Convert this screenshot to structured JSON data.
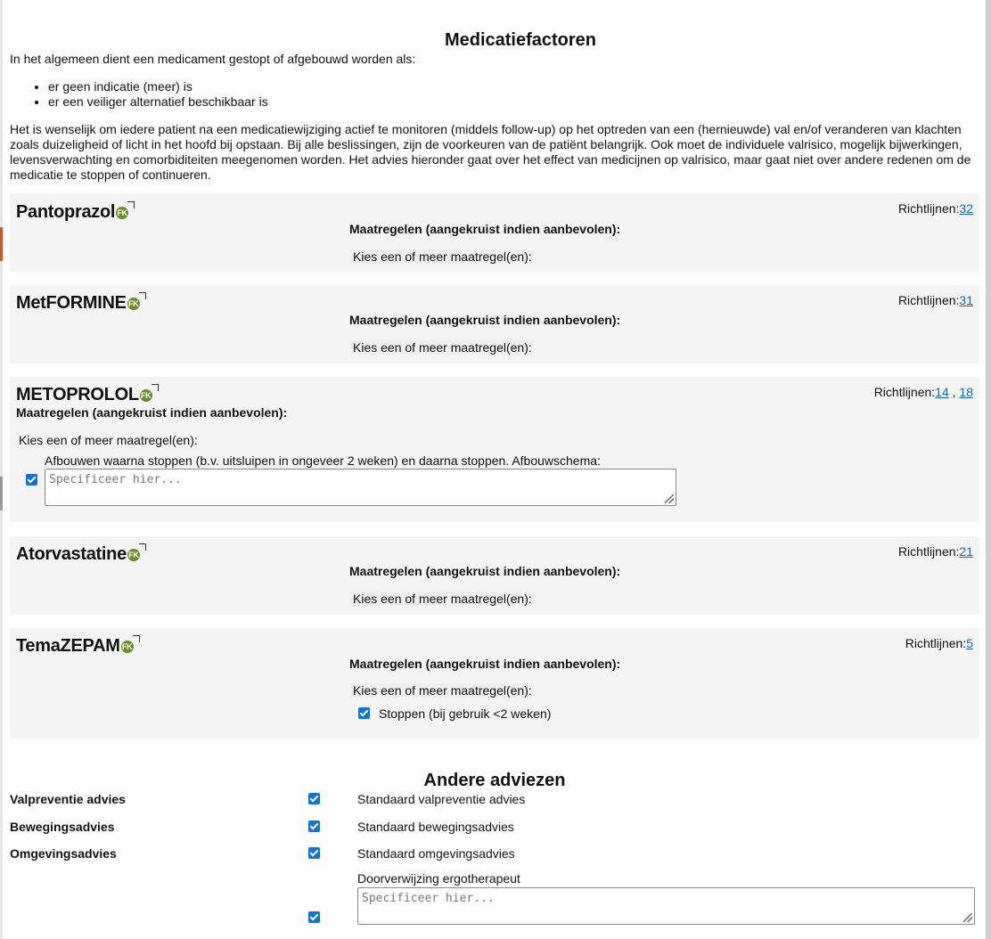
{
  "title": "Medicatiefactoren",
  "intro": {
    "lead": "In het algemeen dient een medicament gestopt of afgebouwd worden als:",
    "bullets": [
      "er geen indicatie (meer) is",
      "er een veiliger alternatief beschikbaar is"
    ],
    "paragraph": "Het is wenselijk om iedere patient na een medicatiewijziging actief te monitoren (middels follow-up) op het optreden van een (hernieuwde) val en/of veranderen van klachten zoals duizeligheid of licht in het hoofd bij opstaan. Bij alle beslissingen, zijn de voorkeuren van de patiënt belangrijk. Ook moet de individuele valrisico, mogelijk bijwerkingen, levensverwachting en comorbiditeiten meegenomen worden. Het advies hieronder gaat over het effect van medicijnen op valrisico, maar gaat niet over andere redenen om de medicatie te stoppen of continueren."
  },
  "labels": {
    "fk_badge": "FK",
    "richtlijnen": "Richtlijnen:",
    "maatregelen": "Maatregelen (aangekruist indien aanbevolen):",
    "kies": "Kies een of meer maatregel(en):",
    "placeholder": "Specificeer hier...",
    "separator": " , "
  },
  "medications": [
    {
      "name": "Pantoprazol",
      "links": [
        "32"
      ]
    },
    {
      "name": "MetFORMINE",
      "links": [
        "31"
      ]
    },
    {
      "name": "METOPROLOL",
      "links": [
        "14",
        "18"
      ],
      "option": "Afbouwen waarna stoppen (b.v. uitsluipen in ongeveer 2 weken) en daarna stoppen. Afbouwschema:",
      "option_checked": true
    },
    {
      "name": "Atorvastatine",
      "links": [
        "21"
      ]
    },
    {
      "name": "TemaZEPAM",
      "links": [
        "5"
      ],
      "option": "Stoppen (bij gebruik <2 weken)",
      "option_checked": true
    }
  ],
  "other": {
    "title": "Andere adviezen",
    "rows": [
      {
        "label": "Valpreventie advies",
        "value": "Standaard valpreventie advies",
        "checked": true
      },
      {
        "label": "Bewegingsadvies",
        "value": "Standaard bewegingsadvies",
        "checked": true
      },
      {
        "label": "Omgevingsadvies",
        "value": "Standaard omgevingsadvies",
        "checked": true
      }
    ],
    "referral": "Doorverwijzing ergotherapeut",
    "referral_checked": true
  },
  "colors": {
    "panel": "#f4f4f4",
    "checkbox": "#0b74de",
    "link": "#1565c0",
    "fk_badge": "#6b8e23"
  }
}
